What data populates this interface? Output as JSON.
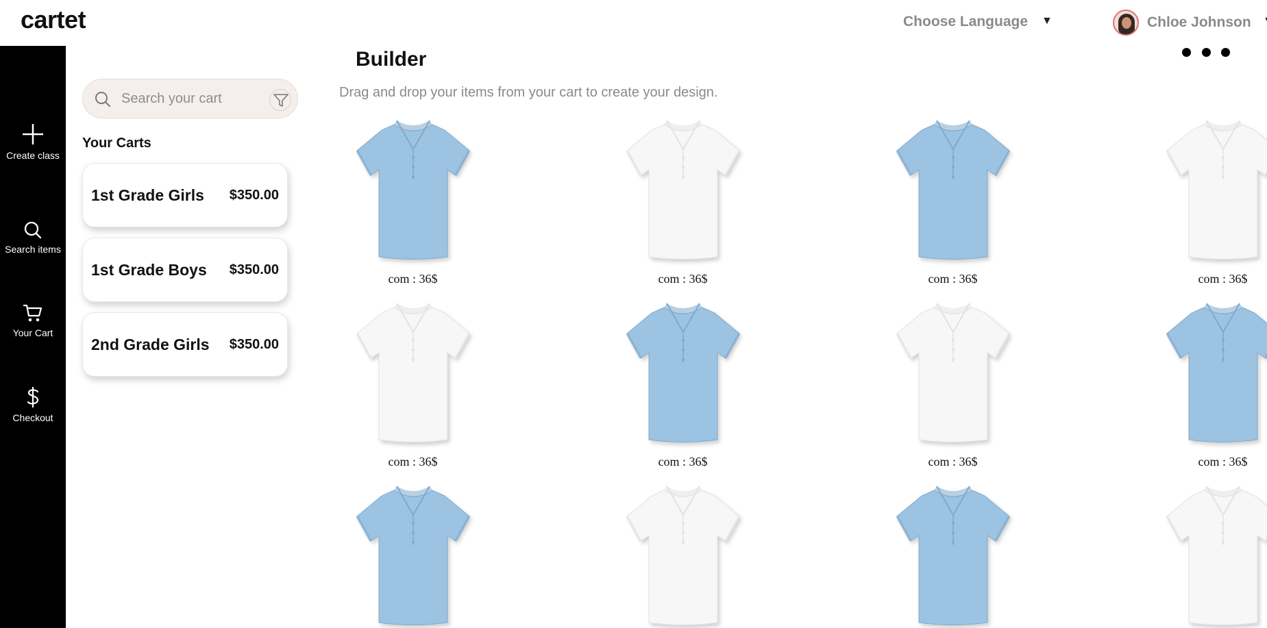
{
  "app": {
    "brand": "cartet"
  },
  "header": {
    "language_label": "Choose Language",
    "language_caret": "▼",
    "user_name": "Chloe Johnson",
    "user_caret": "▼"
  },
  "sidebar": {
    "items": [
      {
        "label": "Create class",
        "icon": "plus-icon"
      },
      {
        "label": "Search items",
        "icon": "search-icon"
      },
      {
        "label": "Your Cart",
        "icon": "cart-icon"
      },
      {
        "label": "Checkout",
        "icon": "dollar-icon"
      }
    ]
  },
  "search": {
    "placeholder": "Search your cart"
  },
  "carts": {
    "title": "Your Carts",
    "items": [
      {
        "name": "1st Grade Girls",
        "price": "$350.00"
      },
      {
        "name": "1st Grade Boys",
        "price": "$350.00"
      },
      {
        "name": "2nd Grade Girls",
        "price": "$350.00"
      }
    ]
  },
  "builder": {
    "title": "Builder",
    "subtitle": "Drag and drop your items from your cart to create your design.",
    "products": [
      {
        "color": "blue",
        "price": "com : 36$"
      },
      {
        "color": "white",
        "price": "com : 36$"
      },
      {
        "color": "blue",
        "price": "com : 36$"
      },
      {
        "color": "white",
        "price": "com : 36$"
      },
      {
        "color": "white",
        "price": "com : 36$"
      },
      {
        "color": "blue",
        "price": "com : 36$"
      },
      {
        "color": "white",
        "price": "com : 36$"
      },
      {
        "color": "blue",
        "price": "com : 36$"
      },
      {
        "color": "blue",
        "price": ""
      },
      {
        "color": "white",
        "price": ""
      },
      {
        "color": "blue",
        "price": ""
      },
      {
        "color": "white",
        "price": ""
      }
    ]
  },
  "colors": {
    "sidebar_bg": "#000000",
    "shirt_blue": "#9cc3e2",
    "shirt_white": "#f7f7f7",
    "muted_text": "#8a8a8a"
  }
}
